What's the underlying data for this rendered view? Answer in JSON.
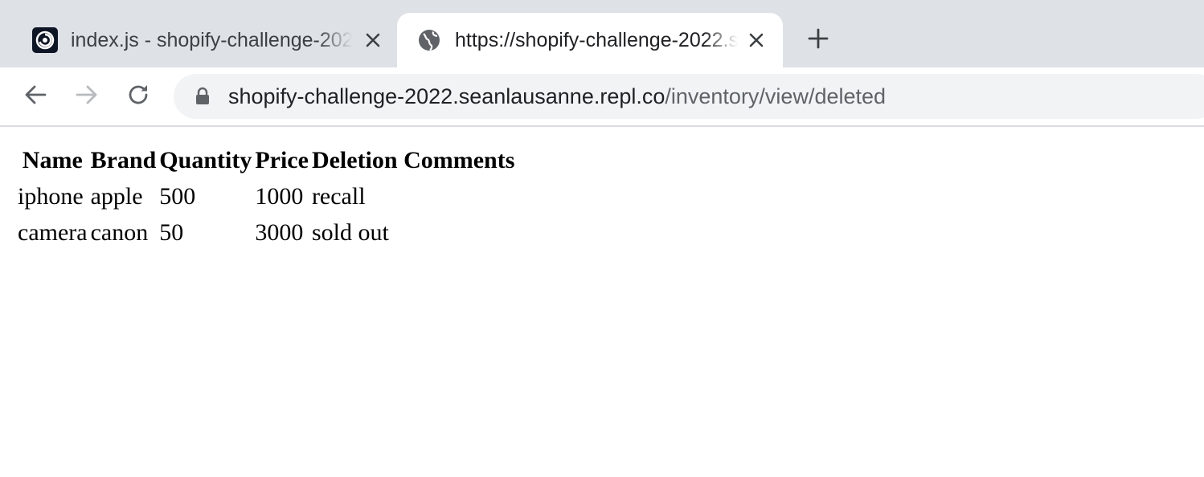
{
  "tabs": [
    {
      "title": "index.js - shopify-challenge-2022 - Replit",
      "favicon": "replit-icon",
      "active": false
    },
    {
      "title": "https://shopify-challenge-2022.seanlausanne.repl.co/inventory/view/deleted",
      "favicon": "globe-icon",
      "active": true
    }
  ],
  "address_bar": {
    "host": "shopify-challenge-2022.seanlausanne.repl.co",
    "path": "/inventory/view/deleted"
  },
  "table": {
    "headers": [
      "Name",
      "Brand",
      "Quantity",
      "Price",
      "Deletion Comments"
    ],
    "rows": [
      [
        "iphone",
        "apple",
        "500",
        "1000",
        "recall"
      ],
      [
        "camera",
        "canon",
        "50",
        "3000",
        "sold out"
      ]
    ]
  },
  "colors": {
    "tabstrip": "#dee1e6",
    "omnibox": "#f1f3f4",
    "icon": "#5f6368",
    "icon_disabled": "#b8babe"
  }
}
